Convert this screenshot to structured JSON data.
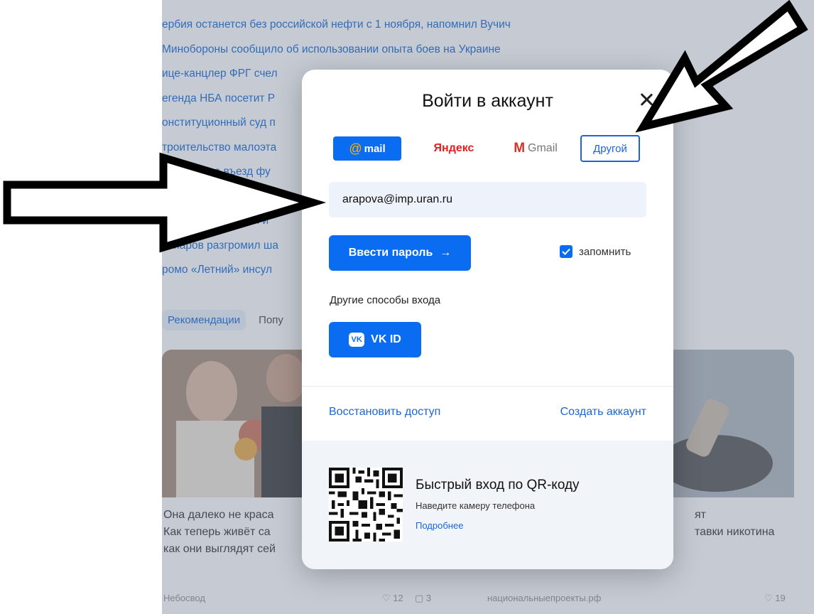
{
  "news": [
    "ербия останется без российской нефти с 1 ноября, напомнил Вучич",
    "Минобороны сообщило об использовании опыта боев на Украине",
    "ице-канцлер ФРГ счел",
    "егенда НБА посетит Р",
    "онституционный суд п",
    "троительство малоэта",
    "а запрет на въезд фу",
    "влеева назвала дв",
    "о. Дубинин омелел и",
    "аспаров разгромил ша",
    "ромо «Летний» инсул"
  ],
  "recommendations": {
    "active": "Рекомендации",
    "other": "Попу"
  },
  "cards": {
    "left": {
      "lines": [
        "Она далеко не краса",
        "Как теперь живёт са",
        "как они выглядят сей"
      ],
      "source": "Небосвод",
      "likes": "12",
      "comments": "3"
    },
    "right": {
      "lines": [
        "ят",
        "тавки никотина"
      ],
      "source": "национальныепроекты.рф",
      "likes": "19"
    }
  },
  "modal": {
    "title": "Войти в аккаунт",
    "providers": {
      "mail_at": "@",
      "mail": "mail",
      "yandex": "Яндекс",
      "gmail_m": "M",
      "gmail": "Gmail",
      "other": "Другой"
    },
    "email_value": "arapova@imp.uran.ru",
    "password_button": "Ввести пароль",
    "password_arrow": "→",
    "remember_label": "запомнить",
    "remember_checked": true,
    "other_methods": "Другие способы входа",
    "vk_logo": "VK",
    "vk_label": "VK ID",
    "restore_link": "Восстановить доступ",
    "create_link": "Создать аккаунт",
    "qr": {
      "title": "Быстрый вход по QR-коду",
      "subtitle": "Наведите камеру телефона",
      "link": "Подробнее"
    }
  },
  "colors": {
    "accent": "#0a6cf0",
    "link": "#1e64d8",
    "overlay": "rgba(120,130,150,0.42)",
    "arrow": "#000000"
  }
}
